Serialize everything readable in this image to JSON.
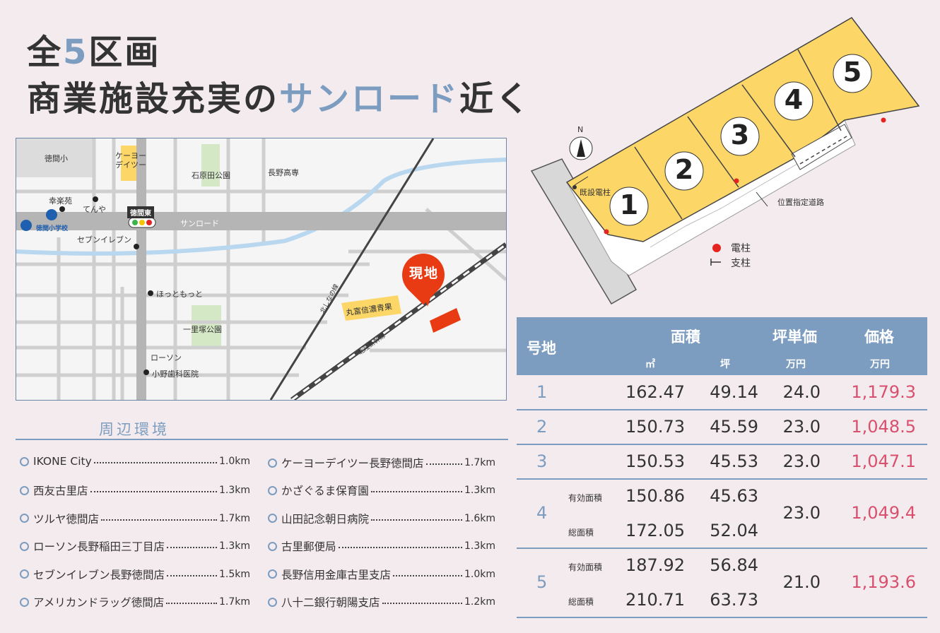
{
  "title": {
    "line1_pre": "全",
    "line1_num": "5",
    "line1_post": "区画",
    "line2_pre": "商業施設充実の",
    "line2_accent": "サンロード",
    "line2_post": "近く"
  },
  "map": {
    "labels": {
      "tokumashou": "徳間小",
      "keiyo": "ケーヨー\nデイツー",
      "ishiharada": "石原田公園",
      "naganokosen": "長野高専",
      "kourakuen": "幸楽苑",
      "tenya": "てんや",
      "tokumahigashi": "徳間東",
      "tokumashogakko": "徳間小学校",
      "sunroad": "サンロード",
      "seven": "セブンイレブン",
      "hottomotto": "ほっともっと",
      "ichirizuka": "一里塚公園",
      "lawson": "ローソン",
      "onoshika": "小野歯科医院",
      "marutomi": "丸富信濃青果",
      "kitashinano": "北しなの線",
      "hokuriku": "北陸新幹線",
      "genchi": "現地"
    }
  },
  "environment": {
    "title": "周辺環境",
    "left": [
      {
        "name": "IKONE City",
        "dist": "1.0km"
      },
      {
        "name": "西友古里店",
        "dist": "1.3km"
      },
      {
        "name": "ツルヤ徳間店",
        "dist": "1.7km"
      },
      {
        "name": "ローソン長野稲田三丁目店",
        "dist": "1.3km"
      },
      {
        "name": "セブンイレブン長野徳間店",
        "dist": "1.5km"
      },
      {
        "name": "アメリカンドラッグ徳間店",
        "dist": "1.7km"
      }
    ],
    "right": [
      {
        "name": "ケーヨーデイツー長野徳間店",
        "dist": "1.7km"
      },
      {
        "name": "かざぐるま保育園",
        "dist": "1.3km"
      },
      {
        "name": "山田記念朝日病院",
        "dist": "1.6km"
      },
      {
        "name": "古里郵便局",
        "dist": "1.3km"
      },
      {
        "name": "長野信用金庫古里支店",
        "dist": "1.0km"
      },
      {
        "name": "八十二銀行朝陽支店",
        "dist": "1.2km"
      }
    ]
  },
  "plot": {
    "lots": [
      "1",
      "2",
      "3",
      "4",
      "5"
    ],
    "north": "N",
    "existing_pole": "既設電柱",
    "designated_road": "位置指定道路",
    "legend_pole": "電柱",
    "legend_stay": "支柱",
    "colors": {
      "lot": "#fcd768",
      "pole": "#e52420",
      "road": "#d8d8d8"
    }
  },
  "table": {
    "headers": {
      "lot": "号地",
      "area": "面積",
      "tsubo_price": "坪単価",
      "price": "価格",
      "sqm": "㎡",
      "tsubo": "坪",
      "man_yen1": "万円",
      "man_yen2": "万円"
    },
    "sub_labels": {
      "effective": "有効面積",
      "total": "総面積"
    },
    "rows": [
      {
        "lot": "1",
        "sqm": "162.47",
        "tsubo": "49.14",
        "unit": "24.0",
        "price": "1,179.3"
      },
      {
        "lot": "2",
        "sqm": "150.73",
        "tsubo": "45.59",
        "unit": "23.0",
        "price": "1,048.5"
      },
      {
        "lot": "3",
        "sqm": "150.53",
        "tsubo": "45.53",
        "unit": "23.0",
        "price": "1,047.1"
      },
      {
        "lot": "4",
        "sqm": "150.86",
        "tsubo": "45.63",
        "sqm2": "172.05",
        "tsubo2": "52.04",
        "unit": "23.0",
        "price": "1,049.4"
      },
      {
        "lot": "5",
        "sqm": "187.92",
        "tsubo": "56.84",
        "sqm2": "210.71",
        "tsubo2": "63.73",
        "unit": "21.0",
        "price": "1,193.6"
      }
    ]
  },
  "colors": {
    "accent": "#7c9cc0",
    "price": "#d9506e",
    "background": "#f4ebee"
  }
}
